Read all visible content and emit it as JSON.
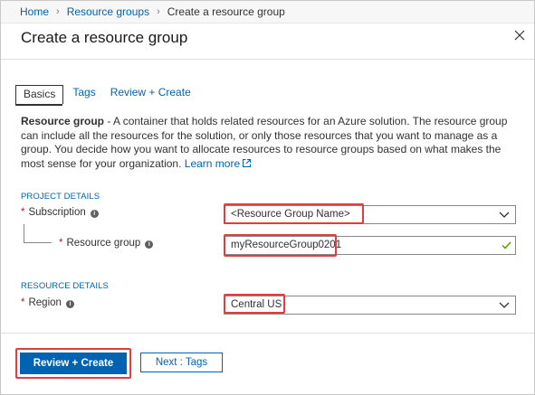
{
  "breadcrumb": {
    "items": [
      "Home",
      "Resource groups",
      "Create a resource group"
    ]
  },
  "header": {
    "title": "Create a resource group"
  },
  "tabs": [
    {
      "label": "Basics",
      "active": true
    },
    {
      "label": "Tags",
      "active": false
    },
    {
      "label": "Review + Create",
      "active": false
    }
  ],
  "description": {
    "bold": "Resource group",
    "text": " - A container that holds related resources for an Azure solution. The resource group can include all the resources for the solution, or only those resources that you want to manage as a group. You decide how you want to allocate resources to resource groups based on what makes the most sense for your organization. ",
    "learn_more": "Learn more"
  },
  "project_details": {
    "section_label": "PROJECT DETAILS",
    "subscription": {
      "label": "Subscription",
      "value": "<Resource Group Name>"
    },
    "resource_group": {
      "label": "Resource group",
      "value": "myResourceGroup0201"
    }
  },
  "resource_details": {
    "section_label": "RESOURCE DETAILS",
    "region": {
      "label": "Region",
      "value": "Central US"
    }
  },
  "footer": {
    "primary_label": "Review + Create",
    "secondary_label": "Next : Tags"
  },
  "colors": {
    "accent": "#0063b1",
    "highlight": "#e03e3e",
    "required": "#a4262c",
    "valid": "#57a300"
  }
}
